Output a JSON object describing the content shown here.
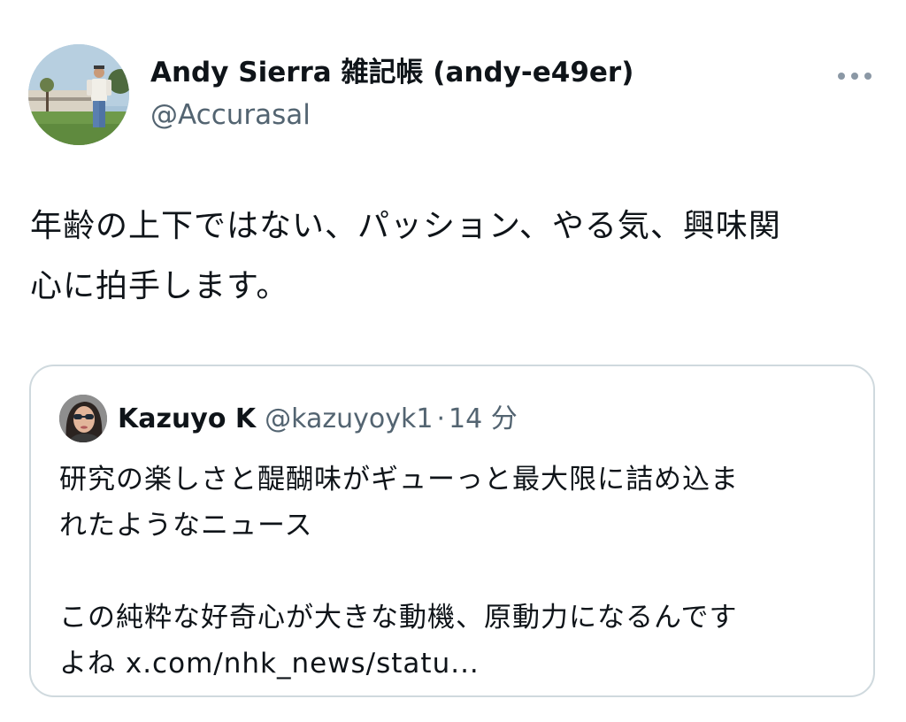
{
  "tweet": {
    "author": {
      "name": "Andy Sierra 雑記帳 (andy-e49er)",
      "handle": "@Accurasal",
      "avatar_icon": "user-avatar"
    },
    "more_icon": "more-dots-icon",
    "text": "年齢の上下ではない、パッション、やる気、興味関\n心に拍手します。"
  },
  "quoted_tweet": {
    "author": {
      "name": "Kazuyo K",
      "handle": "@kazuyoyk1",
      "avatar_icon": "user-avatar"
    },
    "separator": "·",
    "time": "14 分",
    "paragraphs": [
      "研究の楽しさと醍醐味がギューっと最大限に詰め込ま\nれたようなニュース",
      "この純粋な好奇心が大きな動機、原動力になるんです\nよね x.com/nhk_news/statu..."
    ]
  },
  "colors": {
    "text_primary": "#0f1419",
    "text_secondary": "#536471",
    "card_border": "#cfd9de",
    "more_icon": "#8b98a5"
  }
}
